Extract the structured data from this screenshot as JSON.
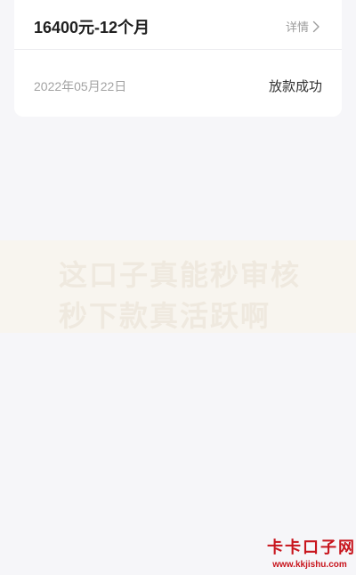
{
  "loan": {
    "title": "16400元-12个月",
    "details_label": "详情",
    "date": "2022年05月22日",
    "status": "放款成功"
  },
  "watermark": {
    "text": "这口子真能秒审核秒下款真活跃啊"
  },
  "site_logo": {
    "name": "卡卡口子网",
    "url": "www.kkjishu.com"
  },
  "colors": {
    "background": "#f6f6f9",
    "card": "#ffffff",
    "logo_red": "#c8151d"
  },
  "icons": {
    "details": "chevron-right-icon"
  }
}
